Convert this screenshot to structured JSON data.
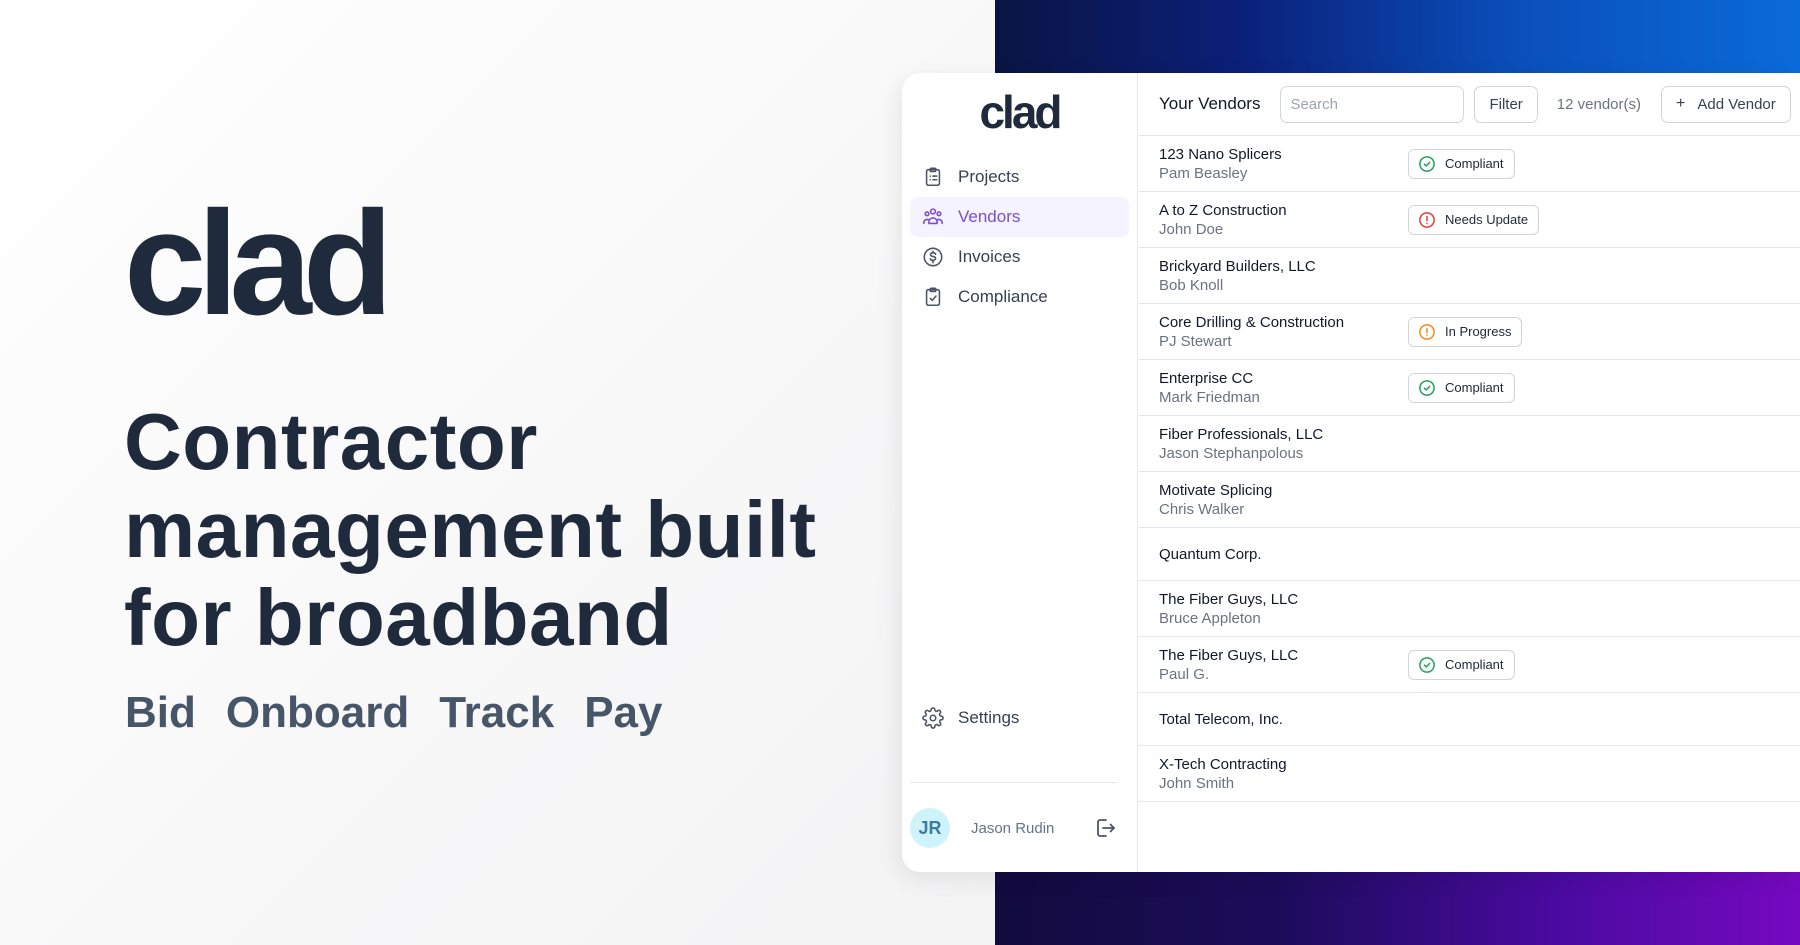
{
  "hero": {
    "logo": "clad",
    "headline": "Contractor management built for broadband",
    "tags": [
      "Bid",
      "Onboard",
      "Track",
      "Pay"
    ]
  },
  "app": {
    "sidebar": {
      "logo": "clad",
      "nav": [
        {
          "label": "Projects",
          "icon": "clipboard-list-icon",
          "active": false
        },
        {
          "label": "Vendors",
          "icon": "users-icon",
          "active": true
        },
        {
          "label": "Invoices",
          "icon": "dollar-circle-icon",
          "active": false
        },
        {
          "label": "Compliance",
          "icon": "clipboard-check-icon",
          "active": false
        }
      ],
      "settings": {
        "label": "Settings",
        "icon": "gear-icon"
      },
      "user": {
        "initials": "JR",
        "name": "Jason Rudin",
        "logout_icon": "logout-icon"
      }
    },
    "toolbar": {
      "title": "Your Vendors",
      "search_placeholder": "Search",
      "search_value": "",
      "filter_label": "Filter",
      "count": "12 vendor(s)",
      "add_label": "Add Vendor",
      "add_icon": "+"
    },
    "vendors": [
      {
        "name": "123 Nano Splicers",
        "contact": "Pam Beasley",
        "status": "Compliant"
      },
      {
        "name": "A to Z Construction",
        "contact": "John Doe",
        "status": "Needs Update"
      },
      {
        "name": "Brickyard Builders, LLC",
        "contact": "Bob Knoll",
        "status": ""
      },
      {
        "name": "Core Drilling & Construction",
        "contact": "PJ Stewart",
        "status": "In Progress"
      },
      {
        "name": "Enterprise CC",
        "contact": "Mark Friedman",
        "status": "Compliant"
      },
      {
        "name": "Fiber Professionals, LLC",
        "contact": "Jason Stephanpolous",
        "status": ""
      },
      {
        "name": "Motivate Splicing",
        "contact": "Chris Walker",
        "status": ""
      },
      {
        "name": "Quantum Corp.",
        "contact": "",
        "status": ""
      },
      {
        "name": "The Fiber Guys, LLC",
        "contact": "Bruce Appleton",
        "status": ""
      },
      {
        "name": "The Fiber Guys, LLC",
        "contact": "Paul G.",
        "status": "Compliant"
      },
      {
        "name": "Total Telecom, Inc.",
        "contact": "",
        "status": ""
      },
      {
        "name": "X-Tech Contracting",
        "contact": "John Smith",
        "status": ""
      }
    ],
    "status_colors": {
      "Compliant": "#22a45d",
      "Needs Update": "#e0403a",
      "In Progress": "#f08c1f"
    },
    "accent": "#7c4dce"
  }
}
